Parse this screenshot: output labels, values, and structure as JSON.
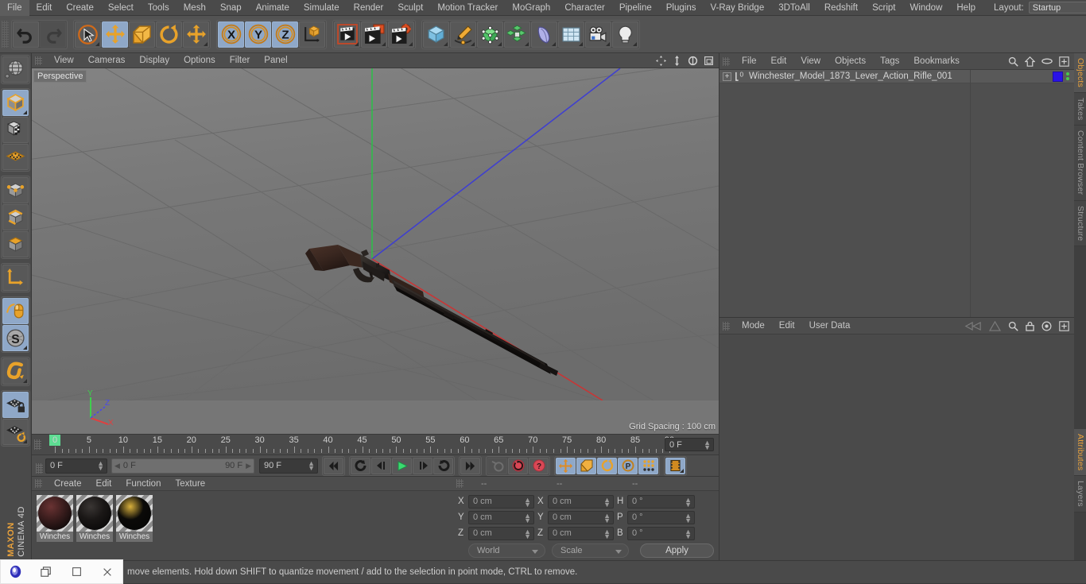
{
  "app": {
    "name": "CINEMA 4D",
    "vendor": "MAXON"
  },
  "menubar": {
    "items": [
      "File",
      "Edit",
      "Create",
      "Select",
      "Tools",
      "Mesh",
      "Snap",
      "Animate",
      "Simulate",
      "Render",
      "Sculpt",
      "Motion Tracker",
      "MoGraph",
      "Character",
      "Pipeline",
      "Plugins",
      "V-Ray Bridge",
      "3DToAll",
      "Redshift",
      "Script",
      "Window",
      "Help"
    ],
    "layout_label": "Layout:",
    "layout_value": "Startup",
    "right_icons": [
      "search-icon",
      "home-icon",
      "minimize-icon",
      "maximize-icon"
    ]
  },
  "toolbar": {
    "groups": [
      {
        "name": "history",
        "buttons": [
          {
            "name": "undo-button",
            "icon": "undo-arrow",
            "state": "normal"
          },
          {
            "name": "redo-button",
            "icon": "redo-arrow",
            "state": "disabled"
          }
        ]
      },
      {
        "name": "transform-tools",
        "buttons": [
          {
            "name": "live-selection-tool",
            "icon": "cursor-circle",
            "state": "normal"
          },
          {
            "name": "move-tool",
            "icon": "move-cross",
            "state": "active"
          },
          {
            "name": "scale-tool",
            "icon": "scale-box",
            "state": "normal"
          },
          {
            "name": "rotate-tool",
            "icon": "rotate-arc",
            "state": "normal"
          },
          {
            "name": "free-move-tool",
            "icon": "move-cross",
            "state": "normal"
          }
        ]
      },
      {
        "name": "axis-locks",
        "buttons": [
          {
            "name": "lock-x-axis",
            "icon": "x-circle",
            "state": "active"
          },
          {
            "name": "lock-y-axis",
            "icon": "y-circle",
            "state": "active"
          },
          {
            "name": "lock-z-axis",
            "icon": "z-circle",
            "state": "active"
          },
          {
            "name": "world-object-axis",
            "icon": "axis-cube",
            "state": "normal"
          }
        ]
      },
      {
        "name": "render-group",
        "buttons": [
          {
            "name": "render-view-button",
            "icon": "clapper-frame",
            "state": "normal"
          },
          {
            "name": "render-to-picture-viewer-button",
            "icon": "clapper-window",
            "state": "normal"
          },
          {
            "name": "edit-render-settings-button",
            "icon": "clapper-gear",
            "state": "normal"
          }
        ]
      },
      {
        "name": "create-group",
        "buttons": [
          {
            "name": "add-primitive-button",
            "icon": "blue-cube",
            "state": "normal"
          },
          {
            "name": "add-spline-button",
            "icon": "pen-spline",
            "state": "normal"
          },
          {
            "name": "add-generator-button",
            "icon": "green-cube",
            "state": "normal"
          },
          {
            "name": "add-array-button",
            "icon": "green-cluster",
            "state": "normal"
          },
          {
            "name": "add-deformer-button",
            "icon": "bend-shape",
            "state": "normal"
          },
          {
            "name": "add-scene-object-button",
            "icon": "floor-grid",
            "state": "normal"
          },
          {
            "name": "add-camera-button",
            "icon": "camera",
            "state": "normal"
          },
          {
            "name": "add-light-button",
            "icon": "light-bulb",
            "state": "normal"
          }
        ]
      }
    ]
  },
  "lefttools": {
    "groups": [
      {
        "buttons": [
          {
            "name": "undo-view-button",
            "icon": "globe-sphere",
            "state": "normal"
          }
        ]
      },
      {
        "buttons": [
          {
            "name": "model-mode-button",
            "icon": "grey-cube",
            "state": "active"
          },
          {
            "name": "texture-mode-button",
            "icon": "checker-cube",
            "state": "normal"
          },
          {
            "name": "workplane-mode-button",
            "icon": "orange-grid",
            "state": "normal"
          }
        ]
      },
      {
        "buttons": [
          {
            "name": "points-mode-button",
            "icon": "cube-points",
            "state": "normal"
          },
          {
            "name": "edges-mode-button",
            "icon": "cube-edges",
            "state": "normal"
          },
          {
            "name": "polygons-mode-button",
            "icon": "cube-polygon",
            "state": "normal"
          }
        ]
      },
      {
        "buttons": [
          {
            "name": "object-axis-mode-button",
            "icon": "axis-corner",
            "state": "normal"
          }
        ]
      },
      {
        "buttons": [
          {
            "name": "enable-axis-button",
            "icon": "mouse-curve",
            "state": "active"
          },
          {
            "name": "soft-selection-button",
            "icon": "s-sphere",
            "state": "active"
          }
        ]
      },
      {
        "buttons": [
          {
            "name": "magnet-tool-button",
            "icon": "magnet",
            "state": "normal"
          }
        ]
      },
      {
        "buttons": [
          {
            "name": "lock-workplane-button",
            "icon": "grid-lock",
            "state": "active"
          },
          {
            "name": "workplane-toggle-button",
            "icon": "grid-rotate",
            "state": "normal"
          }
        ]
      }
    ]
  },
  "viewport": {
    "header_items": [
      "View",
      "Cameras",
      "Display",
      "Options",
      "Filter",
      "Panel"
    ],
    "header_icons": [
      "pan-icon",
      "zoom-icon",
      "rotate-icon",
      "maximize-icon"
    ],
    "perspective_label": "Perspective",
    "grid_spacing": "Grid Spacing : 100 cm",
    "axis_labels": {
      "x": "X",
      "y": "Y",
      "z": "Z"
    },
    "background_color": "#767676",
    "object": "Winchester Model 1873 Lever Action Rifle"
  },
  "timeline": {
    "labels": [
      "0",
      "5",
      "10",
      "15",
      "20",
      "25",
      "30",
      "35",
      "40",
      "45",
      "50",
      "55",
      "60",
      "65",
      "70",
      "75",
      "80",
      "85",
      "90"
    ],
    "min": 0,
    "max": 90,
    "current_frame_field": "0 F"
  },
  "playbar": {
    "current_frame": "0 F",
    "range_start": "0 F",
    "range_end": "90 F",
    "end_frame": "90 F",
    "buttons": [
      {
        "name": "go-to-start-button",
        "icon": "skip-start",
        "state": "normal"
      },
      {
        "name": "previous-key-button",
        "icon": "prev-key-arc",
        "state": "normal"
      },
      {
        "name": "step-back-button",
        "icon": "step-back",
        "state": "normal"
      },
      {
        "name": "play-button",
        "icon": "play-triangle",
        "state": "normal"
      },
      {
        "name": "step-forward-button",
        "icon": "step-forward",
        "state": "normal"
      },
      {
        "name": "next-key-button",
        "icon": "next-key-arc",
        "state": "normal"
      },
      {
        "name": "go-to-end-button",
        "icon": "skip-end",
        "state": "normal"
      },
      {
        "name": "record-active-objects-button",
        "icon": "key-grey",
        "state": "disabled"
      },
      {
        "name": "autokeying-button",
        "icon": "red-circle-arrows",
        "state": "normal"
      },
      {
        "name": "keyframe-selection-button",
        "icon": "red-question",
        "state": "normal"
      },
      {
        "name": "position-key-button",
        "icon": "move-cross",
        "state": "active"
      },
      {
        "name": "scale-key-button",
        "icon": "scale-box",
        "state": "active"
      },
      {
        "name": "rotation-key-button",
        "icon": "rotate-arc",
        "state": "active"
      },
      {
        "name": "parameter-key-button",
        "icon": "p-circle",
        "state": "active"
      },
      {
        "name": "point-level-animation-button",
        "icon": "dots-grid",
        "state": "active"
      },
      {
        "name": "timeline-toggle-button",
        "icon": "film-strip",
        "state": "active"
      }
    ]
  },
  "materials": {
    "menu": [
      "Create",
      "Edit",
      "Function",
      "Texture"
    ],
    "items": [
      {
        "name": "Winchester_Wood",
        "label": "Winches",
        "color": "#3a1d1d",
        "hi": "#6a3333"
      },
      {
        "name": "Winchester_Metal",
        "label": "Winches",
        "color": "#1a1716",
        "hi": "#3a3634"
      },
      {
        "name": "Winchester_Dark",
        "label": "Winches",
        "color": "#0b0a08",
        "hi": "#d8b03c"
      }
    ]
  },
  "coordinates": {
    "col_headers": [
      "--",
      "--",
      "--"
    ],
    "rows": [
      {
        "label1": "X",
        "value1": "0 cm",
        "label2": "X",
        "value2": "0 cm",
        "label3": "H",
        "value3": "0 °"
      },
      {
        "label1": "Y",
        "value1": "0 cm",
        "label2": "Y",
        "value2": "0 cm",
        "label3": "P",
        "value3": "0 °"
      },
      {
        "label1": "Z",
        "value1": "0 cm",
        "label2": "Z",
        "value2": "0 cm",
        "label3": "B",
        "value3": "0 °"
      }
    ],
    "system": "World",
    "mode": "Scale",
    "apply_label": "Apply"
  },
  "object_manager": {
    "menu": [
      "File",
      "Edit",
      "View",
      "Objects",
      "Tags",
      "Bookmarks"
    ],
    "header_icons": [
      "search-icon",
      "home-icon",
      "ellipse-icon",
      "plus-box-icon"
    ],
    "object_name": "Winchester_Model_1873_Lever_Action_Rifle_001",
    "layer_badge": "0",
    "tag_color": "#2a12e8"
  },
  "attribute_manager": {
    "menu": [
      "Mode",
      "Edit",
      "User Data"
    ],
    "header_icons": [
      "history-back-icon",
      "history-forward-icon",
      "search-icon",
      "lock-icon",
      "target-icon",
      "plus-box-icon"
    ]
  },
  "vertical_tabs": {
    "top": [
      "Objects",
      "Takes",
      "Content Browser",
      "Structure"
    ],
    "bottom": [
      "Attributes",
      "Layers"
    ],
    "selected_top": "Objects",
    "selected_bottom": "Attributes",
    "accent": "#e8a13c"
  },
  "statusbar": {
    "text": "move elements. Hold down SHIFT to quantize movement / add to the selection in point mode, CTRL to remove.",
    "taskbar_icons": [
      "app-icon",
      "restore-icon",
      "maximize-icon",
      "close-icon"
    ]
  }
}
